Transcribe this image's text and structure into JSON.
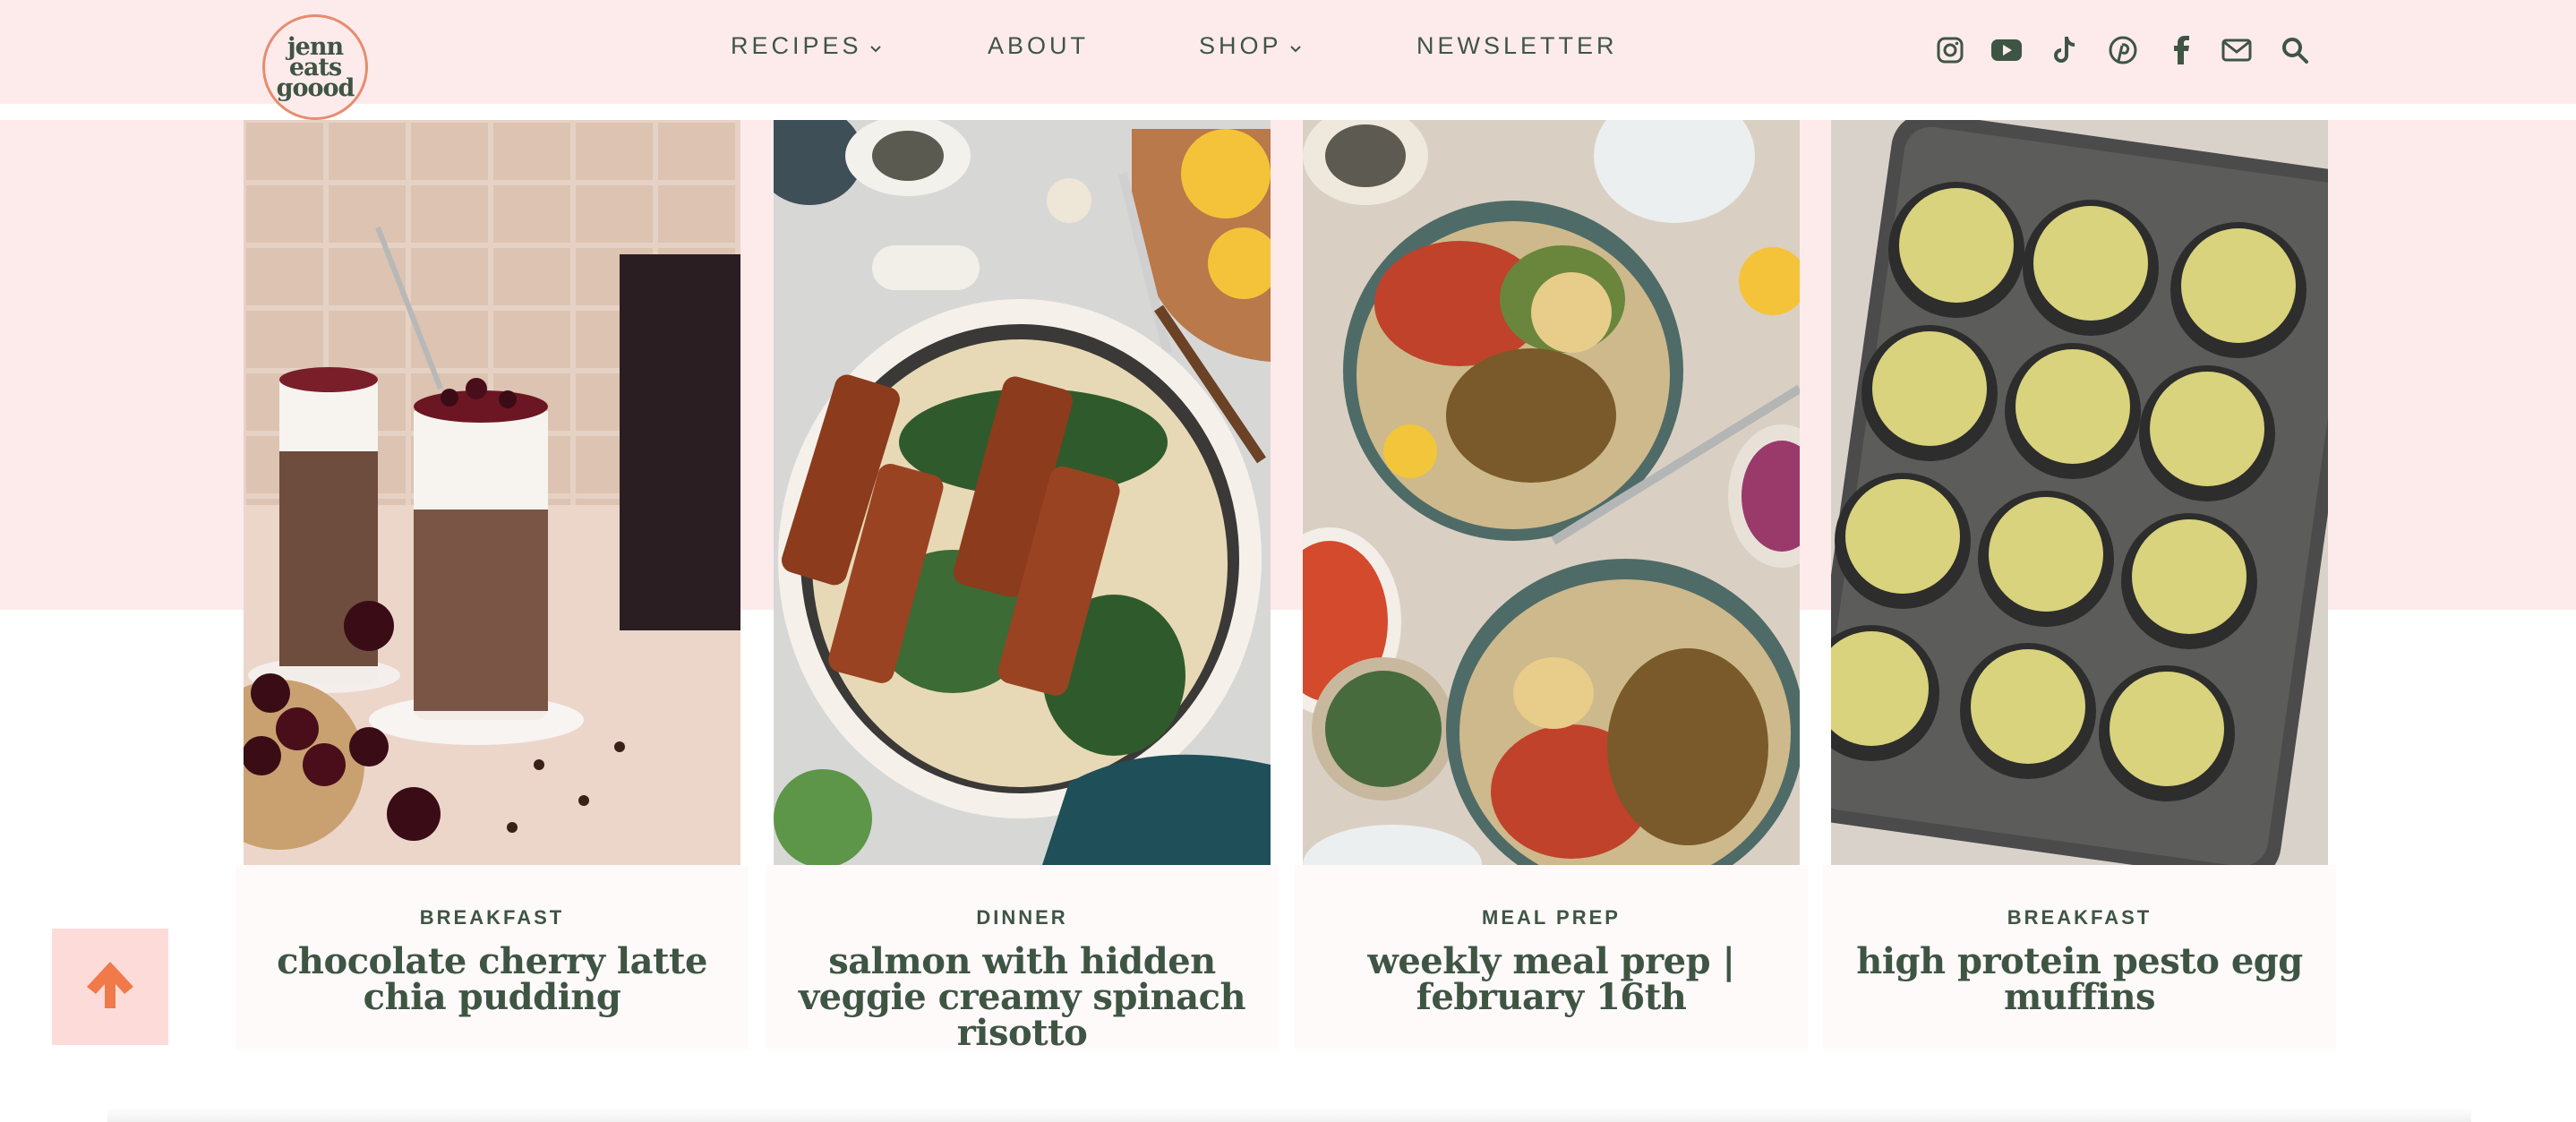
{
  "site": {
    "logo_lines": [
      "jenn",
      "eats",
      "goood"
    ]
  },
  "nav": {
    "recipes": "RECIPES",
    "about": "ABOUT",
    "shop": "SHOP",
    "newsletter": "NEWSLETTER"
  },
  "social": {
    "icons": [
      "instagram-icon",
      "youtube-icon",
      "tiktok-icon",
      "pinterest-icon",
      "facebook-icon",
      "mail-icon",
      "search-icon"
    ]
  },
  "cards": [
    {
      "category": "BREAKFAST",
      "title": "chocolate cherry latte chia pudding"
    },
    {
      "category": "DINNER",
      "title": "salmon with hidden veggie creamy spinach risotto"
    },
    {
      "category": "MEAL PREP",
      "title": "weekly meal prep | february 16th"
    },
    {
      "category": "BREAKFAST",
      "title": "high protein pesto egg muffins"
    }
  ],
  "colors": {
    "header_bg": "#fdebec",
    "brand_green": "#3f5544",
    "accent_orange": "#f07a4a",
    "back_to_top_bg": "#fddbd9"
  },
  "back_to_top": {
    "icon": "arrow-up-icon"
  }
}
